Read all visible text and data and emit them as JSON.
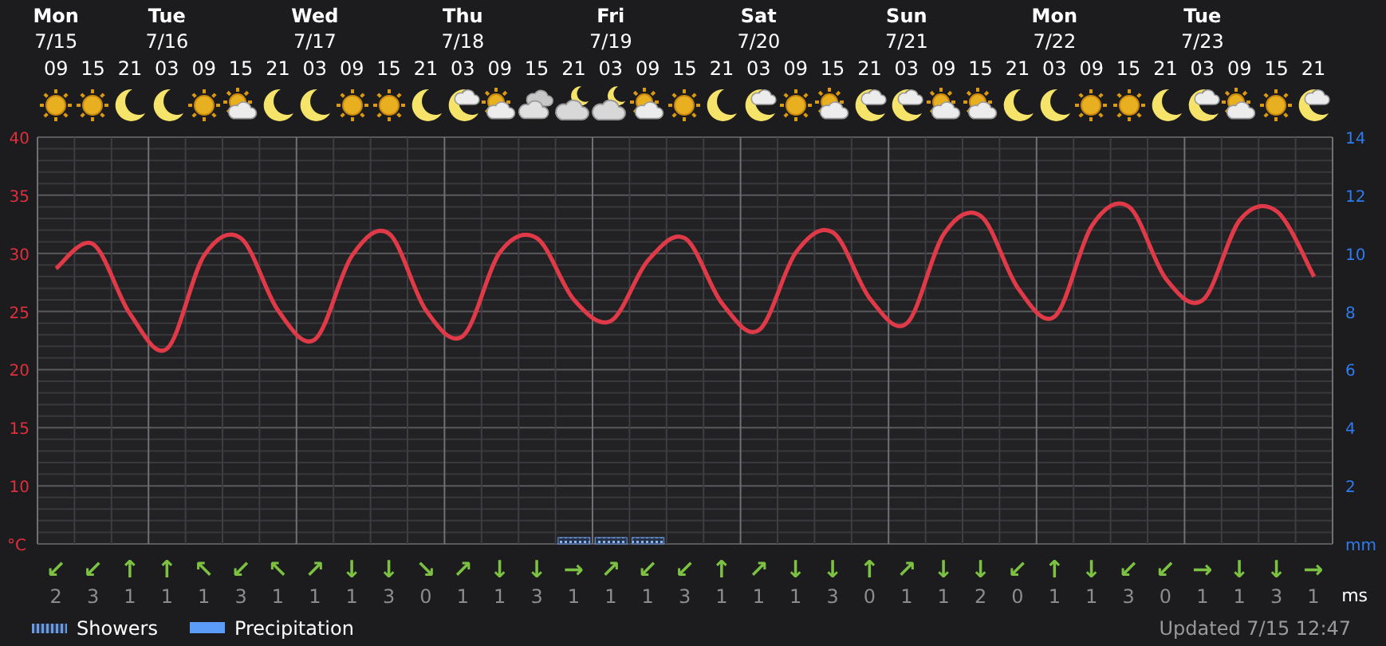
{
  "days": [
    {
      "name": "Mon",
      "date": "7/15",
      "slots": [
        {
          "hour": "09",
          "kind": "sun",
          "arrow": "↙",
          "wind": "2"
        },
        {
          "hour": "15",
          "kind": "sun",
          "arrow": "↙",
          "wind": "3"
        },
        {
          "hour": "21",
          "kind": "moon",
          "arrow": "↑",
          "wind": "1"
        }
      ]
    },
    {
      "name": "Tue",
      "date": "7/16",
      "slots": [
        {
          "hour": "03",
          "kind": "moon",
          "arrow": "↑",
          "wind": "1"
        },
        {
          "hour": "09",
          "kind": "sun",
          "arrow": "↖",
          "wind": "1"
        },
        {
          "hour": "15",
          "kind": "sun-cloud",
          "arrow": "↙",
          "wind": "3"
        },
        {
          "hour": "21",
          "kind": "moon",
          "arrow": "↖",
          "wind": "1"
        }
      ]
    },
    {
      "name": "Wed",
      "date": "7/17",
      "slots": [
        {
          "hour": "03",
          "kind": "moon",
          "arrow": "↗",
          "wind": "1"
        },
        {
          "hour": "09",
          "kind": "sun",
          "arrow": "↓",
          "wind": "1"
        },
        {
          "hour": "15",
          "kind": "sun",
          "arrow": "↓",
          "wind": "3"
        },
        {
          "hour": "21",
          "kind": "moon",
          "arrow": "↘",
          "wind": "0"
        }
      ]
    },
    {
      "name": "Thu",
      "date": "7/18",
      "slots": [
        {
          "hour": "03",
          "kind": "moon-cloud",
          "arrow": "↗",
          "wind": "1"
        },
        {
          "hour": "09",
          "kind": "sun-cloud",
          "arrow": "↓",
          "wind": "1"
        },
        {
          "hour": "15",
          "kind": "cloud",
          "arrow": "↓",
          "wind": "3"
        },
        {
          "hour": "21",
          "kind": "night-cloud",
          "arrow": "→",
          "wind": "1",
          "showers": true
        }
      ]
    },
    {
      "name": "Fri",
      "date": "7/19",
      "slots": [
        {
          "hour": "03",
          "kind": "night-cloud",
          "arrow": "↗",
          "wind": "1",
          "showers": true
        },
        {
          "hour": "09",
          "kind": "sun-cloud",
          "arrow": "↙",
          "wind": "1",
          "showers": true
        },
        {
          "hour": "15",
          "kind": "sun",
          "arrow": "↙",
          "wind": "3"
        },
        {
          "hour": "21",
          "kind": "moon",
          "arrow": "↑",
          "wind": "1"
        }
      ]
    },
    {
      "name": "Sat",
      "date": "7/20",
      "slots": [
        {
          "hour": "03",
          "kind": "moon-cloud",
          "arrow": "↗",
          "wind": "1"
        },
        {
          "hour": "09",
          "kind": "sun",
          "arrow": "↓",
          "wind": "1"
        },
        {
          "hour": "15",
          "kind": "sun-cloud",
          "arrow": "↓",
          "wind": "3"
        },
        {
          "hour": "21",
          "kind": "moon-cloud",
          "arrow": "↑",
          "wind": "0"
        }
      ]
    },
    {
      "name": "Sun",
      "date": "7/21",
      "slots": [
        {
          "hour": "03",
          "kind": "moon-cloud",
          "arrow": "↗",
          "wind": "1"
        },
        {
          "hour": "09",
          "kind": "sun-cloud",
          "arrow": "↓",
          "wind": "1"
        },
        {
          "hour": "15",
          "kind": "sun-cloud",
          "arrow": "↓",
          "wind": "2"
        },
        {
          "hour": "21",
          "kind": "moon",
          "arrow": "↙",
          "wind": "0"
        }
      ]
    },
    {
      "name": "Mon",
      "date": "7/22",
      "slots": [
        {
          "hour": "03",
          "kind": "moon",
          "arrow": "↑",
          "wind": "1"
        },
        {
          "hour": "09",
          "kind": "sun",
          "arrow": "↓",
          "wind": "1"
        },
        {
          "hour": "15",
          "kind": "sun",
          "arrow": "↙",
          "wind": "3"
        },
        {
          "hour": "21",
          "kind": "moon",
          "arrow": "↙",
          "wind": "0"
        }
      ]
    },
    {
      "name": "Tue",
      "date": "7/23",
      "slots": [
        {
          "hour": "03",
          "kind": "moon-cloud",
          "arrow": "→",
          "wind": "1"
        },
        {
          "hour": "09",
          "kind": "sun-cloud",
          "arrow": "↓",
          "wind": "1"
        },
        {
          "hour": "15",
          "kind": "sun",
          "arrow": "↓",
          "wind": "3"
        },
        {
          "hour": "21",
          "kind": "moon-cloud",
          "arrow": "→",
          "wind": "1"
        }
      ]
    }
  ],
  "chart": {
    "chart_data": {
      "type": "line",
      "ylabel": "°C",
      "ylim": [
        5,
        40
      ],
      "yticks": [
        10,
        15,
        20,
        25,
        30,
        35,
        40
      ],
      "y2label": "mm",
      "y2lim": [
        0,
        14
      ],
      "y2ticks": [
        2,
        4,
        6,
        8,
        10,
        12,
        14
      ],
      "series": [
        {
          "color": "#e03a48",
          "values": [
            28.7,
            30.8,
            24.8,
            21.8,
            29.8,
            31.3,
            25.1,
            22.6,
            29.8,
            31.7,
            25.1,
            22.9,
            30.1,
            31.3,
            26,
            24.2,
            29.4,
            31.3,
            25.7,
            23.4,
            30.1,
            31.8,
            26.1,
            24,
            31.7,
            33.2,
            27,
            24.6,
            32.4,
            34,
            27.8,
            26,
            32.9,
            33.6,
            28
          ]
        }
      ]
    }
  },
  "wind_unit": "ms",
  "legend": [
    {
      "label": "Showers",
      "kind": "hatched",
      "color": "#6a9ae0"
    },
    {
      "label": "Precipitation",
      "kind": "solid",
      "color": "#5a9cf8"
    }
  ],
  "updated": "Updated 7/15 12:47"
}
